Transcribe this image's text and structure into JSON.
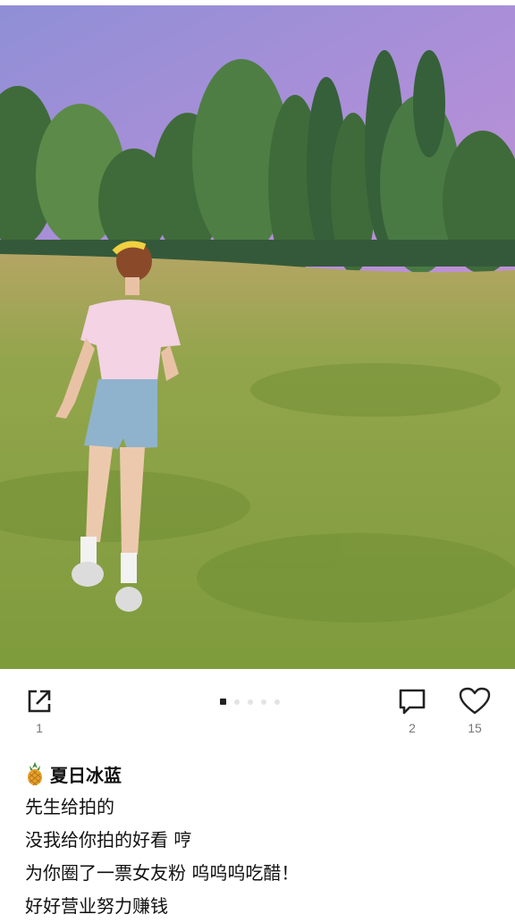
{
  "post": {
    "author": "夏日冰蓝",
    "caption_lines": [
      "先生给拍的",
      "没我给你拍的好看 哼",
      "为你圈了一票女友粉 呜呜呜吃醋！",
      "好好营业努力赚钱"
    ]
  },
  "actions": {
    "share_count": "1",
    "comment_count": "2",
    "like_count": "15"
  },
  "carousel": {
    "total": 5,
    "active_index": 0
  },
  "icons": {
    "share": "share-icon",
    "comment": "comment-icon",
    "like": "heart-icon",
    "avatar": "pineapple-icon"
  },
  "colors": {
    "text": "#111111",
    "muted": "#777777",
    "dot_inactive": "#e4e4e4",
    "dot_active": "#222222"
  }
}
